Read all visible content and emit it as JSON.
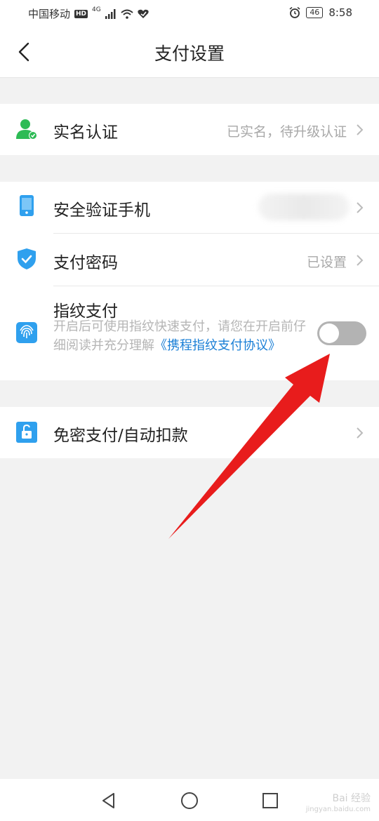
{
  "status_bar": {
    "carrier": "中国移动",
    "network": "4G",
    "battery": "46",
    "time": "8:58"
  },
  "header": {
    "title": "支付设置"
  },
  "rows": {
    "real_name": {
      "label": "实名认证",
      "value": "已实名，待升级认证"
    },
    "phone": {
      "label": "安全验证手机"
    },
    "password": {
      "label": "支付密码",
      "value": "已设置"
    },
    "fingerprint": {
      "label": "指纹支付",
      "desc_text": "开启后可使用指纹快速支付，请您在开启前仔细阅读并充分理解",
      "desc_link": "《携程指纹支付协议》",
      "enabled": false
    },
    "autopay": {
      "label": "免密支付/自动扣款"
    }
  },
  "watermark": {
    "line1": "Bai",
    "line2": "经验",
    "line3": "jingyan.baidu.com"
  },
  "colors": {
    "accent_blue": "#2fa0ee",
    "green": "#2dbb55",
    "link": "#1a7fd6",
    "arrow_red": "#e81c1c"
  }
}
